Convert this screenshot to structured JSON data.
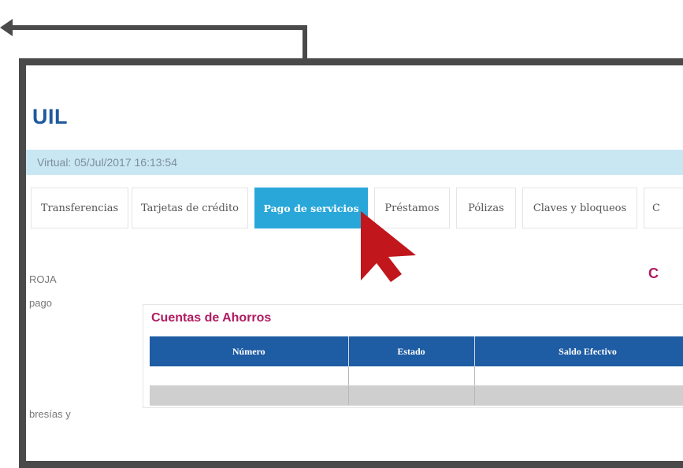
{
  "header": {
    "bank_name_partial": "UIL"
  },
  "session": {
    "virtual_date_text": "Virtual: 05/Jul/2017 16:13:54"
  },
  "tabs": [
    {
      "label": "Transferencias",
      "active": false
    },
    {
      "label": "Tarjetas de crédito",
      "active": false
    },
    {
      "label": "Pago de servicios",
      "active": true
    },
    {
      "label": "Préstamos",
      "active": false
    },
    {
      "label": "Pólizas",
      "active": false
    },
    {
      "label": "Claves y bloqueos",
      "active": false
    },
    {
      "label": "C",
      "active": false
    }
  ],
  "sidebar": {
    "name_fragment": "ROJA",
    "pago_fragment": "pago",
    "membresias_fragment": "bresías y"
  },
  "content": {
    "heading_partial": "C",
    "accounts": {
      "title": "Cuentas de Ahorros",
      "columns": [
        "Número",
        "Estado",
        "Saldo Efectivo"
      ],
      "rows": [
        [
          "",
          "",
          ""
        ],
        [
          "",
          "",
          ""
        ]
      ]
    }
  },
  "colors": {
    "accent": "#2aa7d9",
    "brand_title": "#1f5a9e",
    "section_title": "#b01c62",
    "table_header": "#1e5ca3",
    "cursor": "#c0161c",
    "frame": "#4a4a4a"
  },
  "icons": [
    "connector-arrow-icon",
    "mouse-pointer-icon"
  ]
}
